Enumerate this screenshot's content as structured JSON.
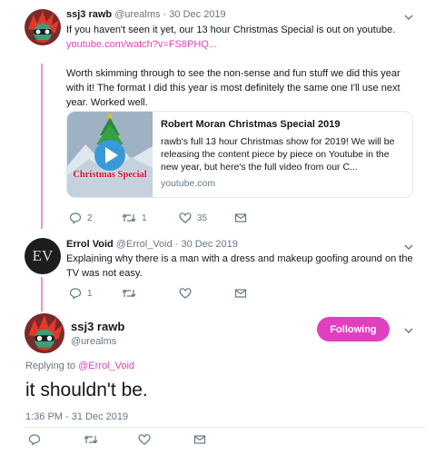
{
  "tweet1": {
    "name": "ssj3 rawb",
    "handle": "@urealms",
    "date": "· 30 Dec 2019",
    "text_line1": "If you haven't seen it yet, our 13 hour Christmas Special is out on youtube.",
    "link": "youtube.com/watch?v=FS8PHQ...",
    "text_para2_line1": "Worth skimming through to see the non-sense and fun stuff we did this year",
    "text_para2_line2": "with it! The format I did this year is most definitely the same one I'll use next",
    "text_para2_line3": "year. Worked well.",
    "card": {
      "title": "Robert Moran Christmas Special 2019",
      "desc_line1": "rawb's full 13 hour Christmas show for 2019! We will be",
      "desc_line2": "releasing the content piece by piece on Youtube in the",
      "desc_line3": "new year, but here's the full video from our C...",
      "domain": "youtube.com",
      "thumb_text": "Christmas Special"
    },
    "replies": "2",
    "retweets": "1",
    "likes": "35"
  },
  "tweet2": {
    "name": "Errol Void",
    "handle": "@Errol_Void",
    "date": "· 30 Dec 2019",
    "avatar_text": "EV",
    "text_line1": "Explaining why there is a man with a dress and makeup goofing around on the",
    "text_line2": "TV was not easy.",
    "replies": "1"
  },
  "main_tweet": {
    "name": "ssj3 rawb",
    "handle": "@urealms",
    "follow_label": "Following",
    "replying_prefix": "Replying to",
    "replying_handle": "@Errol_Void",
    "text": "it shouldn't be.",
    "timestamp": "1:36 PM - 31 Dec 2019"
  },
  "colors": {
    "accent": "#e040c0",
    "thread_line": "#f48fd9",
    "muted": "#657786"
  }
}
